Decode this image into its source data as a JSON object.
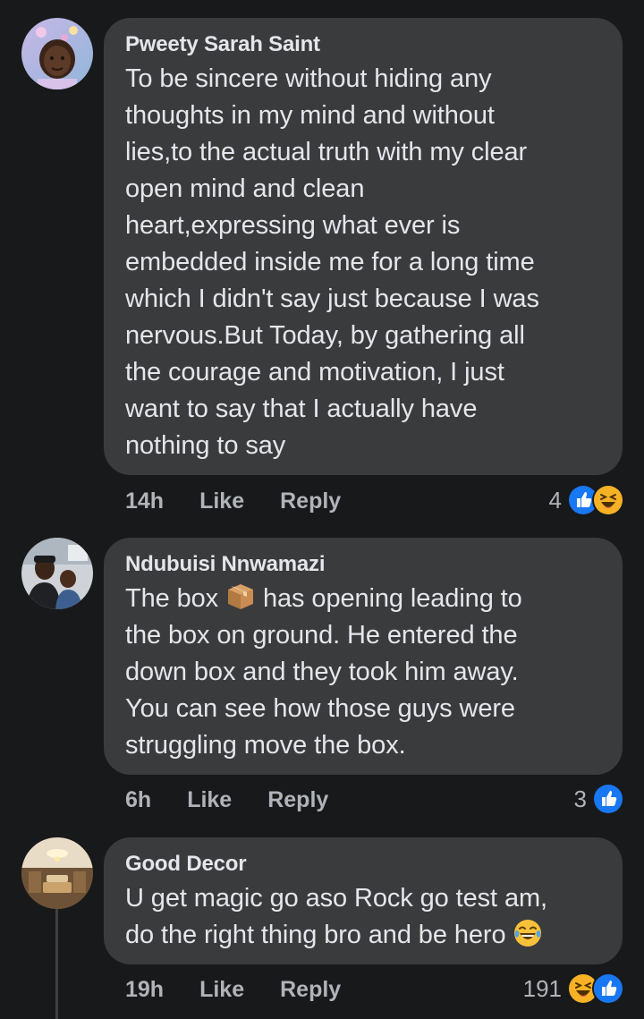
{
  "comments": [
    {
      "author": "Pweety Sarah Saint",
      "lines": [
        "To be sincere without hiding any",
        "thoughts in my mind and without",
        "lies,to the actual truth with my clear",
        "open mind and clean",
        "heart,expressing what ever is",
        "embedded inside me for a long time",
        "which I didn't say just because I was",
        "nervous.But Today, by gathering all",
        "the courage and motivation, I just",
        "want to say that I actually have",
        "nothing to say"
      ],
      "time": "14h",
      "like_label": "Like",
      "reply_label": "Reply",
      "reaction_count": "4",
      "reactions": [
        "like-icon",
        "haha-icon"
      ]
    },
    {
      "author": "Ndubuisi Nnwamazi",
      "line1_before": "The box ",
      "line1_emoji": "package-emoji",
      "line1_after": " has opening leading to",
      "lines": [
        "the box on ground. He entered the",
        "down box and they took him away.",
        "You can see how those guys were",
        "struggling move the box."
      ],
      "time": "6h",
      "like_label": "Like",
      "reply_label": "Reply",
      "reaction_count": "3",
      "reactions": [
        "like-icon"
      ]
    },
    {
      "author": "Good Decor",
      "lines": [
        "U get magic go aso Rock go test am,"
      ],
      "last_line": "do the right thing bro and be hero",
      "last_emoji": "tears-of-joy-emoji",
      "time": "19h",
      "like_label": "Like",
      "reply_label": "Reply",
      "reaction_count": "191",
      "reactions": [
        "haha-icon",
        "like-icon"
      ]
    }
  ],
  "colors": {
    "background": "#18191a",
    "bubble": "#3a3b3c",
    "text": "#e4e6eb",
    "secondary_text": "#b0b3b8",
    "like_blue": "#1877f2",
    "haha_yellow": "#f7b125"
  }
}
